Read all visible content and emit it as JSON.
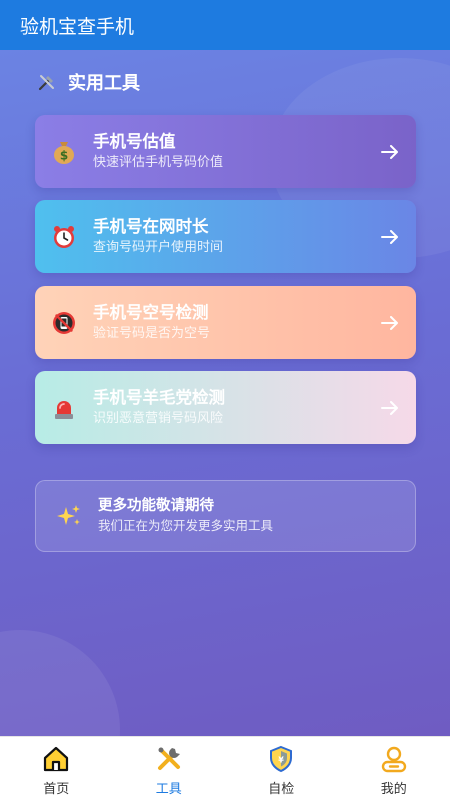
{
  "app": {
    "title": "验机宝查手机"
  },
  "section": {
    "title": "实用工具",
    "icon": "tools-icon"
  },
  "tools": [
    {
      "title": "手机号估值",
      "subtitle": "快速评估手机号码价值",
      "icon": "money-bag-icon"
    },
    {
      "title": "手机号在网时长",
      "subtitle": "查询号码开户使用时间",
      "icon": "alarm-clock-icon"
    },
    {
      "title": "手机号空号检测",
      "subtitle": "验证号码是否为空号",
      "icon": "no-phone-icon"
    },
    {
      "title": "手机号羊毛党检测",
      "subtitle": "识别恶意营销号码风险",
      "icon": "siren-icon"
    }
  ],
  "more": {
    "title": "更多功能敬请期待",
    "subtitle": "我们正在为您开发更多实用工具",
    "icon": "sparkles-icon"
  },
  "tabs": [
    {
      "label": "首页",
      "icon": "home-icon",
      "active": false
    },
    {
      "label": "工具",
      "icon": "tools-icon",
      "active": true
    },
    {
      "label": "自检",
      "icon": "shield-icon",
      "active": false
    },
    {
      "label": "我的",
      "icon": "user-icon",
      "active": false
    }
  ],
  "colors": {
    "accent": "#1e7be0",
    "appbar": "#1e7be0"
  }
}
